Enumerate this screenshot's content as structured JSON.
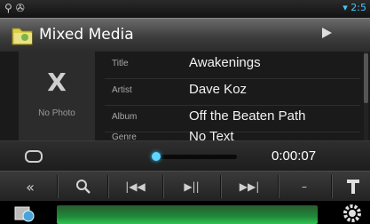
{
  "status": {
    "left_icons": "signal-icon bluetooth-icon",
    "right_text": "2:5"
  },
  "header": {
    "title": "Mixed Media"
  },
  "photo": {
    "mark": "X",
    "label": "No Photo"
  },
  "info_rows": [
    {
      "label": "Title",
      "value": "Awakenings"
    },
    {
      "label": "Artist",
      "value": "Dave Koz"
    },
    {
      "label": "Album",
      "value": "Off the Beaten Path"
    },
    {
      "label": "Genre",
      "value": "No Text"
    }
  ],
  "playback": {
    "time": "0:00:07",
    "progress": 0.02
  },
  "controls": {
    "back": "«",
    "prev": "|◀◀",
    "play_pause": "▶||",
    "next": "▶▶|",
    "minus": "–"
  },
  "colors": {
    "accent": "#42c8ff",
    "bar": "#2fc24e"
  }
}
